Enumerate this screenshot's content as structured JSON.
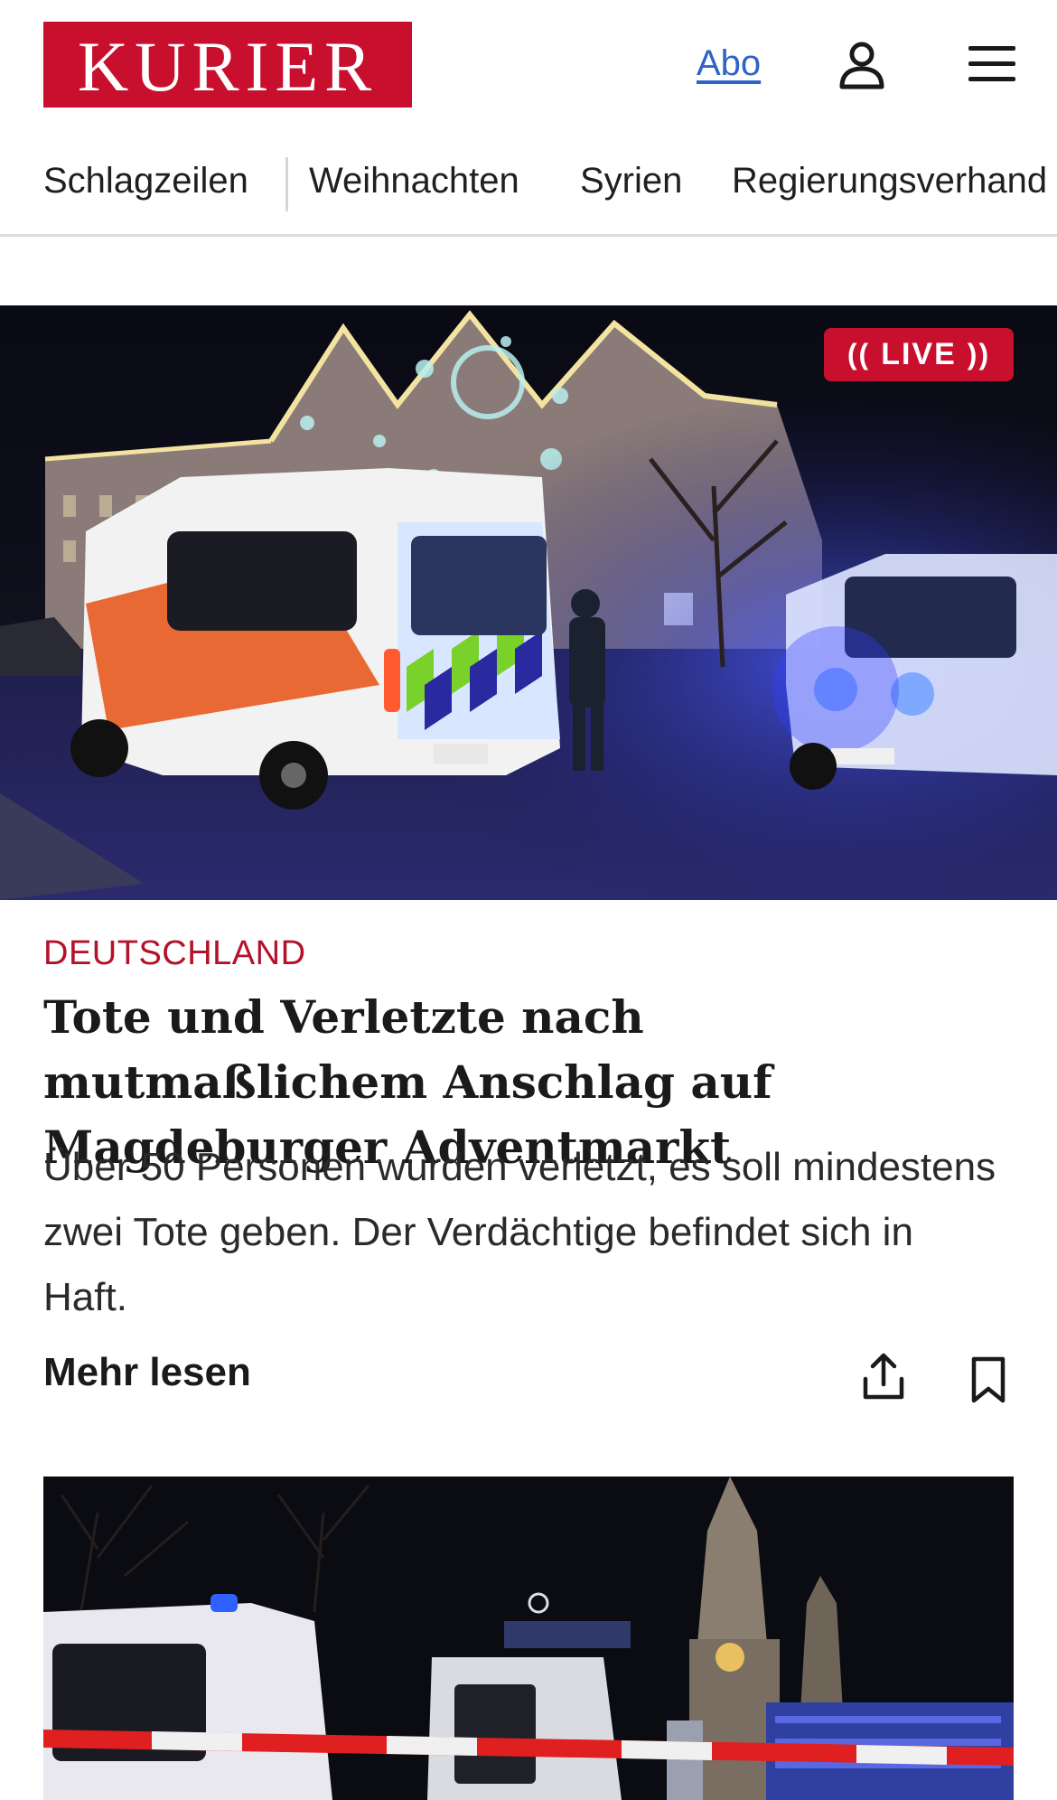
{
  "header": {
    "logo": "KURIER",
    "abo_label": "Abo",
    "icons": {
      "user": "user-icon",
      "menu": "menu-icon"
    }
  },
  "nav": {
    "items": [
      "Schlagzeilen",
      "Weihnachten",
      "Syrien",
      "Regierungsverhand"
    ]
  },
  "article": {
    "live_label": "LIVE",
    "kicker": "DEUTSCHLAND",
    "headline": "Tote und Verletzte nach mutmaßlichem Anschlag auf Magdeburger Adventmarkt",
    "teaser": "Über 50 Personen wurden verletzt, es soll mindestens zwei Tote geben. Der Verdächtige befindet sich in Haft.",
    "more_label": "Mehr lesen",
    "icons": {
      "share": "share-icon",
      "bookmark": "bookmark-icon"
    }
  },
  "colors": {
    "brand_red": "#c8102e",
    "kicker_red": "#b3122a",
    "link_blue": "#2f63c6"
  }
}
